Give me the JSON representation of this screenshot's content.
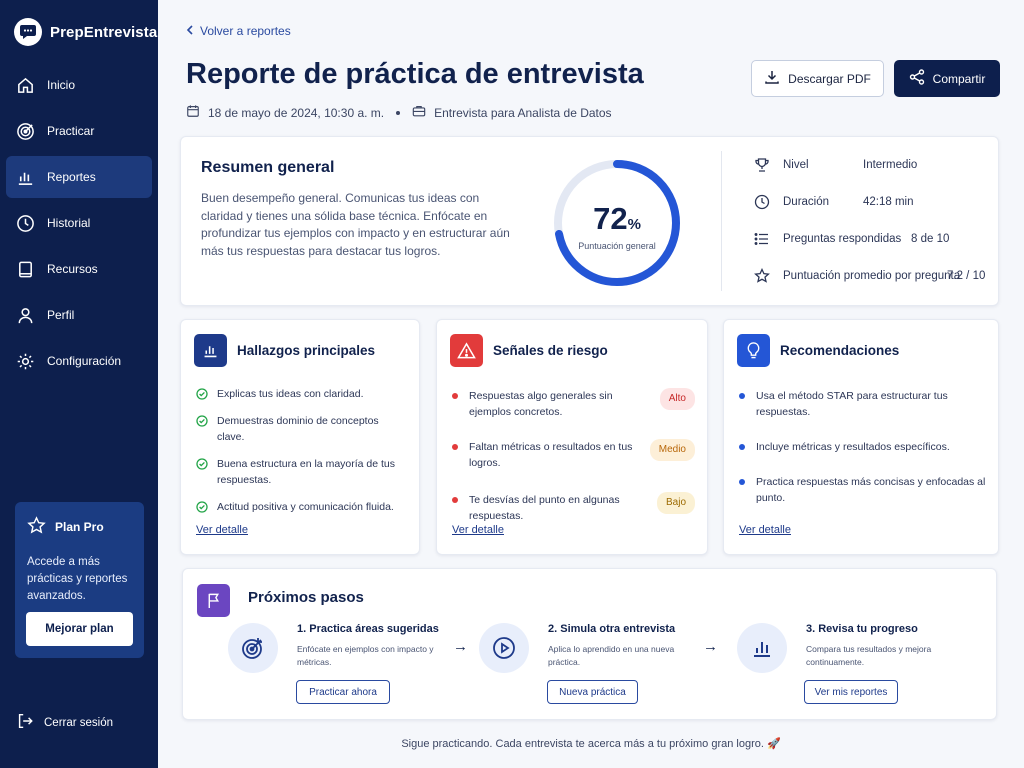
{
  "app": {
    "name": "PrepEntrevista"
  },
  "sidebar": {
    "items": [
      {
        "label": "Inicio",
        "icon": "home-icon"
      },
      {
        "label": "Practicar",
        "icon": "target-icon"
      },
      {
        "label": "Reportes",
        "icon": "bar-chart-icon",
        "active": true
      },
      {
        "label": "Historial",
        "icon": "clock-icon"
      },
      {
        "label": "Recursos",
        "icon": "book-icon"
      },
      {
        "label": "Perfil",
        "icon": "user-icon"
      },
      {
        "label": "Configuración",
        "icon": "gear-icon"
      }
    ],
    "promo": {
      "title": "Plan Pro",
      "text": "Accede a más prácticas y reportes avanzados.",
      "button": "Mejorar plan"
    },
    "logout": "Cerrar sesión"
  },
  "header": {
    "back": "Volver a reportes",
    "title": "Reporte de práctica de entrevista",
    "date": "18 de mayo de 2024, 10:30 a. m.",
    "interview": "Entrevista para Analista de Datos",
    "download": "Descargar PDF",
    "share": "Compartir"
  },
  "summary": {
    "title": "Resumen general",
    "text": "Buen desempeño general. Comunicas tus ideas con claridad y tienes una sólida base técnica. Enfócate en profundizar tus ejemplos con impacto y en estructurar aún más tus respuestas para destacar tus logros.",
    "score": 72,
    "score_value": "72",
    "score_unit": "%",
    "score_label": "Puntuación general",
    "stats": [
      {
        "label": "Nivel",
        "value": "Intermedio"
      },
      {
        "label": "Duración",
        "value": "42:18 min"
      },
      {
        "label": "Preguntas respondidas",
        "value": "8 de 10"
      },
      {
        "label": "Puntuación promedio por pregunta",
        "value": "7.2 / 10"
      }
    ]
  },
  "findings": {
    "title": "Hallazgos principales",
    "items": [
      "Explicas tus ideas con claridad.",
      "Demuestras dominio de conceptos clave.",
      "Buena estructura en la mayoría de tus respuestas.",
      "Actitud positiva y comunicación fluida."
    ],
    "link": "Ver detalle"
  },
  "risks": {
    "title": "Señales de riesgo",
    "items": [
      {
        "text": "Respuestas algo generales sin ejemplos concretos.",
        "tag": "Alto"
      },
      {
        "text": "Faltan métricas o resultados en tus logros.",
        "tag": "Medio"
      },
      {
        "text": "Te desvías del punto en algunas respuestas.",
        "tag": "Bajo"
      }
    ],
    "link": "Ver detalle"
  },
  "recommendations": {
    "title": "Recomendaciones",
    "items": [
      "Usa el método STAR para estructurar tus respuestas.",
      "Incluye métricas y resultados específicos.",
      "Practica respuestas más concisas y enfocadas al punto."
    ],
    "link": "Ver detalle"
  },
  "next_steps": {
    "title": "Próximos pasos",
    "steps": [
      {
        "title": "1. Practica áreas sugeridas",
        "desc": "Enfócate en ejemplos con impacto y métricas.",
        "button": "Practicar ahora"
      },
      {
        "title": "2. Simula otra entrevista",
        "desc": "Aplica lo aprendido en una nueva práctica.",
        "button": "Nueva práctica"
      },
      {
        "title": "3. Revisa tu progreso",
        "desc": "Compara tus resultados y mejora continuamente.",
        "button": "Ver mis reportes"
      }
    ]
  },
  "footer": "Sigue practicando. Cada entrevista te acerca más a tu próximo gran logro. 🚀",
  "colors": {
    "sidebar": "#0d1f4d",
    "accent": "#2456d6",
    "success": "#22a447",
    "danger": "#e23b3b"
  }
}
